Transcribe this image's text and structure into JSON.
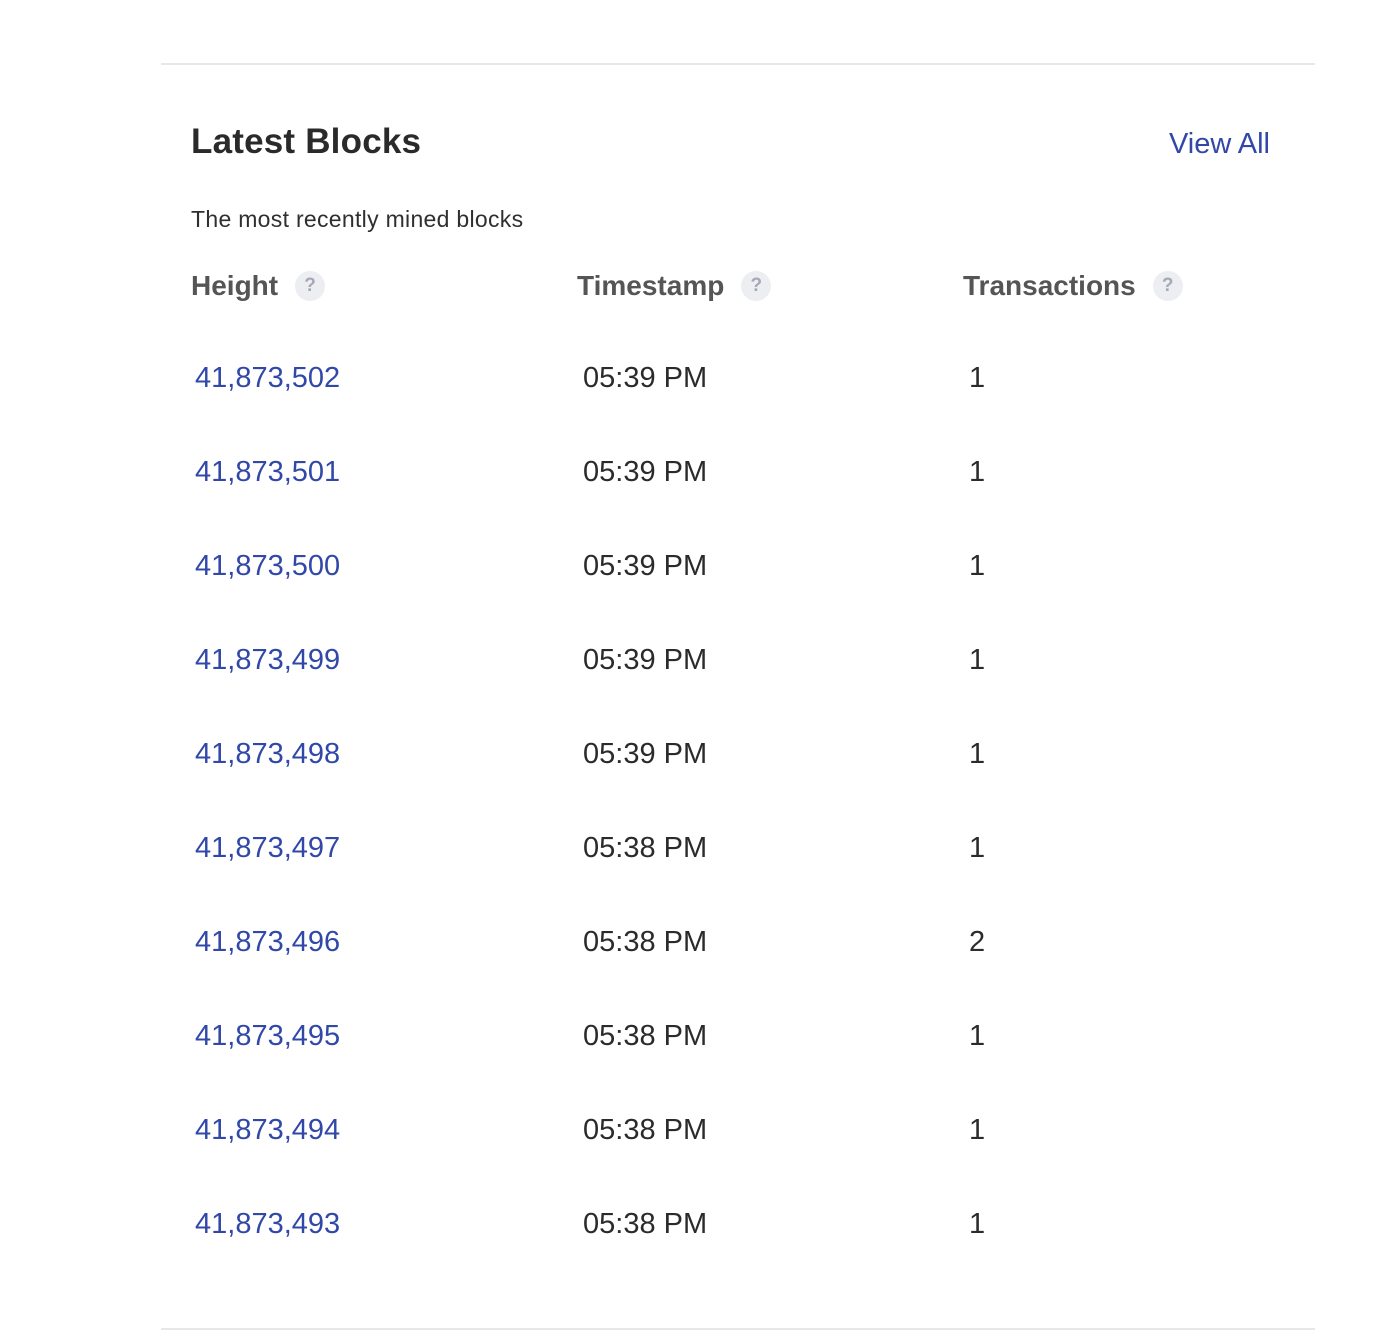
{
  "section": {
    "title": "Latest Blocks",
    "view_all_label": "View All",
    "subtitle": "The most recently mined blocks"
  },
  "columns": {
    "height": "Height",
    "timestamp": "Timestamp",
    "transactions": "Transactions",
    "help_glyph": "?"
  },
  "blocks": [
    {
      "height": "41,873,502",
      "timestamp": "05:39 PM",
      "transactions": "1"
    },
    {
      "height": "41,873,501",
      "timestamp": "05:39 PM",
      "transactions": "1"
    },
    {
      "height": "41,873,500",
      "timestamp": "05:39 PM",
      "transactions": "1"
    },
    {
      "height": "41,873,499",
      "timestamp": "05:39 PM",
      "transactions": "1"
    },
    {
      "height": "41,873,498",
      "timestamp": "05:39 PM",
      "transactions": "1"
    },
    {
      "height": "41,873,497",
      "timestamp": "05:38 PM",
      "transactions": "1"
    },
    {
      "height": "41,873,496",
      "timestamp": "05:38 PM",
      "transactions": "2"
    },
    {
      "height": "41,873,495",
      "timestamp": "05:38 PM",
      "transactions": "1"
    },
    {
      "height": "41,873,494",
      "timestamp": "05:38 PM",
      "transactions": "1"
    },
    {
      "height": "41,873,493",
      "timestamp": "05:38 PM",
      "transactions": "1"
    }
  ],
  "colors": {
    "link": "#3148a8",
    "text": "#2b2b2b",
    "header_text": "#555555",
    "divider": "#e6e7ea",
    "help_icon_bg": "#eceef2"
  }
}
